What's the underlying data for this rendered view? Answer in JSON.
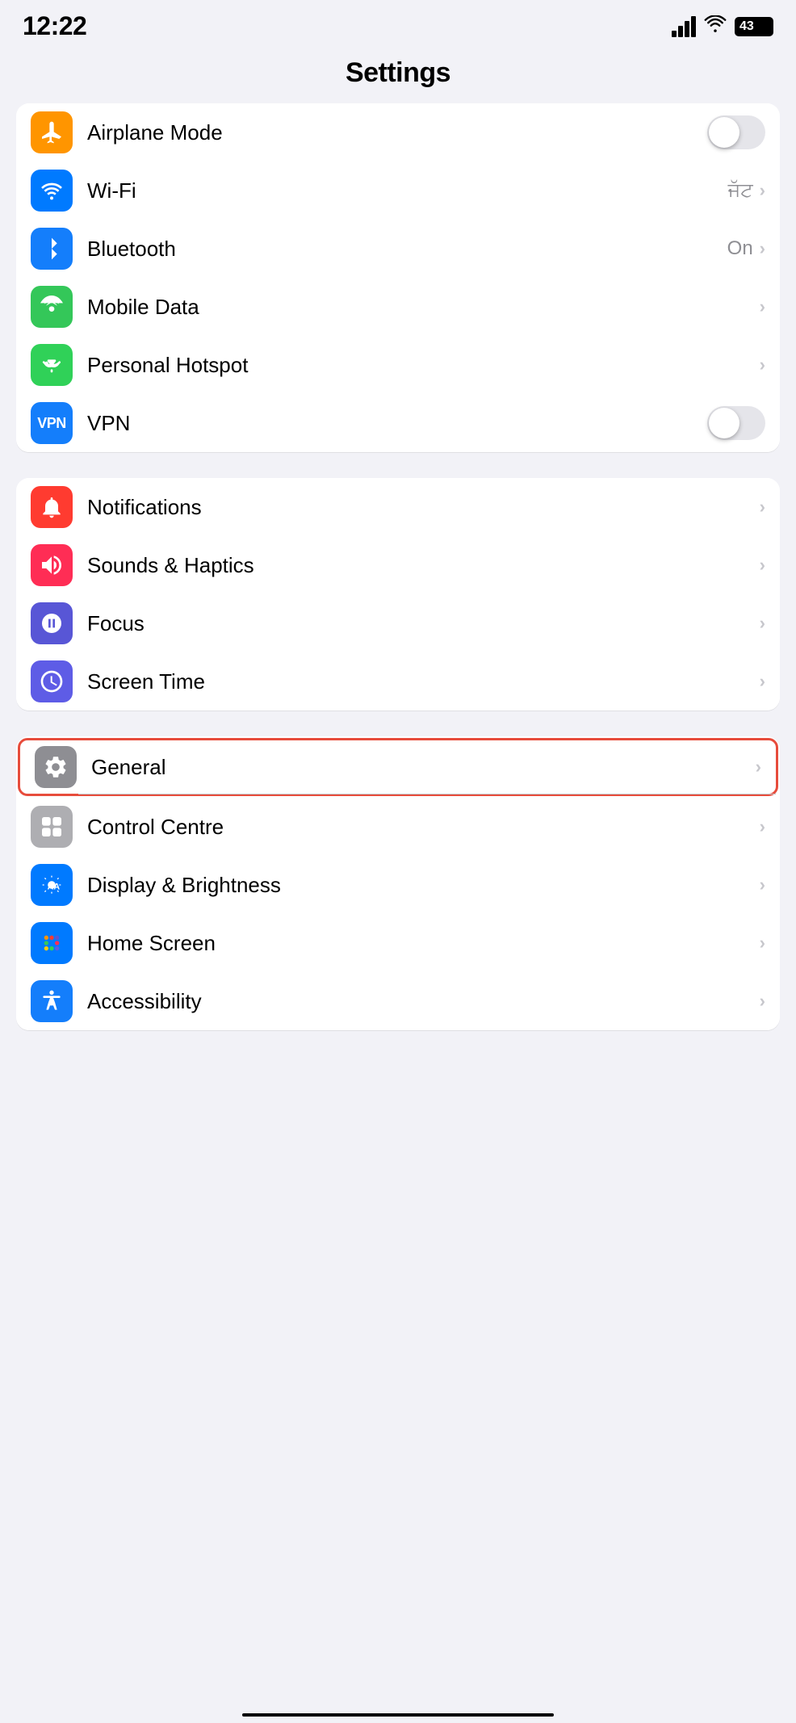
{
  "statusBar": {
    "time": "12:22",
    "battery": "43"
  },
  "header": {
    "title": "Settings"
  },
  "groups": [
    {
      "id": "connectivity",
      "rows": [
        {
          "id": "airplane-mode",
          "icon": "airplane-icon",
          "iconColor": "icon-orange",
          "label": "Airplane Mode",
          "control": "toggle",
          "toggleOn": false,
          "value": "",
          "hasChevron": false
        },
        {
          "id": "wifi",
          "icon": "wifi-icon",
          "iconColor": "icon-blue",
          "label": "Wi-Fi",
          "control": "value-chevron",
          "value": "ਜੱਟ",
          "hasChevron": true
        },
        {
          "id": "bluetooth",
          "icon": "bluetooth-icon",
          "iconColor": "icon-blue-dark",
          "label": "Bluetooth",
          "control": "value-chevron",
          "value": "On",
          "hasChevron": true
        },
        {
          "id": "mobile-data",
          "icon": "signal-icon",
          "iconColor": "icon-green",
          "label": "Mobile Data",
          "control": "chevron",
          "value": "",
          "hasChevron": true
        },
        {
          "id": "personal-hotspot",
          "icon": "hotspot-icon",
          "iconColor": "icon-green-dark",
          "label": "Personal Hotspot",
          "control": "chevron",
          "value": "",
          "hasChevron": true
        },
        {
          "id": "vpn",
          "icon": "vpn-icon",
          "iconColor": "icon-vpn",
          "label": "VPN",
          "control": "toggle",
          "toggleOn": false,
          "value": "",
          "hasChevron": false
        }
      ]
    },
    {
      "id": "system",
      "rows": [
        {
          "id": "notifications",
          "icon": "bell-icon",
          "iconColor": "icon-red",
          "label": "Notifications",
          "control": "chevron",
          "value": "",
          "hasChevron": true
        },
        {
          "id": "sounds-haptics",
          "icon": "speaker-icon",
          "iconColor": "icon-red-pink",
          "label": "Sounds & Haptics",
          "control": "chevron",
          "value": "",
          "hasChevron": true
        },
        {
          "id": "focus",
          "icon": "moon-icon",
          "iconColor": "icon-purple",
          "label": "Focus",
          "control": "chevron",
          "value": "",
          "hasChevron": true
        },
        {
          "id": "screen-time",
          "icon": "screentime-icon",
          "iconColor": "icon-purple-dark",
          "label": "Screen Time",
          "control": "chevron",
          "value": "",
          "hasChevron": true
        }
      ]
    }
  ],
  "bottomRows": [
    {
      "id": "general",
      "icon": "gear-icon",
      "iconColor": "icon-gray",
      "label": "General",
      "control": "chevron",
      "value": "",
      "hasChevron": true,
      "highlighted": true
    },
    {
      "id": "control-centre",
      "icon": "control-centre-icon",
      "iconColor": "icon-gray-light",
      "label": "Control Centre",
      "control": "chevron",
      "value": "",
      "hasChevron": true,
      "highlighted": false
    },
    {
      "id": "display-brightness",
      "icon": "display-icon",
      "iconColor": "icon-blue-aa",
      "label": "Display & Brightness",
      "control": "chevron",
      "value": "",
      "hasChevron": true,
      "highlighted": false
    },
    {
      "id": "home-screen",
      "icon": "home-screen-icon",
      "iconColor": "icon-home",
      "label": "Home Screen",
      "control": "chevron",
      "value": "",
      "hasChevron": true,
      "highlighted": false
    },
    {
      "id": "accessibility",
      "icon": "accessibility-icon",
      "iconColor": "icon-accessibility",
      "label": "Accessibility",
      "control": "chevron",
      "value": "",
      "hasChevron": true,
      "highlighted": false
    }
  ]
}
